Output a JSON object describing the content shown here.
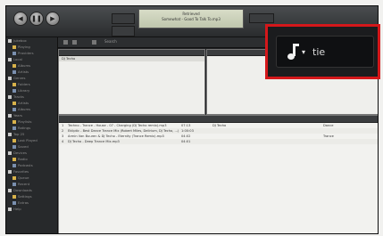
{
  "now_playing": {
    "line1": "Retrieved",
    "line2": "Somewhat - Good To Talk To.mp3"
  },
  "toolbar": {
    "crumb": "Search"
  },
  "sidebar": {
    "items": [
      "Jukebox",
      "Playing",
      "Providers",
      "Local",
      "Albums",
      "Artists",
      "Genres",
      "Folders",
      "Library",
      "Tracks",
      "Artists",
      "Albums",
      "Years",
      "Playlists",
      "Ratings",
      "Top 25",
      "Last Played",
      "Saved",
      "Devices",
      "Radio",
      "Podcasts",
      "Favorites",
      "Queue",
      "Recent",
      "Downloads",
      "Settings",
      "Extras",
      "Help"
    ]
  },
  "browser": {
    "left_row": "DJ Techo",
    "right_row": ""
  },
  "tracks": {
    "rows": [
      {
        "num": "1",
        "title": "Techno - Trance - House - 07 - Charging (DJ Techo remix).mp3",
        "time": "07:13",
        "artist": "DJ Techo",
        "genre": "Dance"
      },
      {
        "num": "2",
        "title": "Ekliptic - Best Dance Trance Mix (Robert Miles, Delirium, DJ Techo, ...)",
        "time": "1:00:03",
        "artist": "",
        "genre": ""
      },
      {
        "num": "3",
        "title": "Armin Van Buuren & DJ Techo - Eternity (Trance Remix).mp3",
        "time": "04:02",
        "artist": "",
        "genre": "Trance"
      },
      {
        "num": "4",
        "title": "DJ Techo - Deep Trance Mix.mp3",
        "time": "04:01",
        "artist": "",
        "genre": ""
      }
    ]
  },
  "search": {
    "value": "tie",
    "icon": "music-note-icon"
  },
  "colors": {
    "callout_border": "#d4171a"
  }
}
